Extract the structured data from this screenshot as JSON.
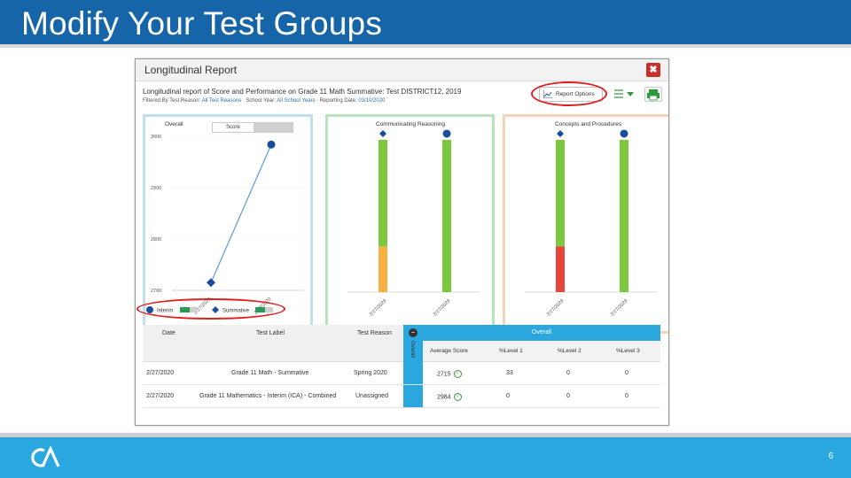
{
  "slide": {
    "title": "Modify Your Test Groups",
    "page_number": "6",
    "colors": {
      "header": "#1565a8",
      "footer": "#2aa7df",
      "highlight": "#e01e1e"
    }
  },
  "report": {
    "window_title": "Longitudinal Report",
    "description": "Longitudinal report of Score and Performance on Grade 11 Math   Summative: Test DISTRICT12, 2019",
    "filter_prefix": "Filtered By Test Reason:",
    "filter_test_reason": "All Test Reasons",
    "filter_school_year_label": "School Year:",
    "filter_school_year": "All School Years",
    "reporting_date_label": "Reporting Date:",
    "reporting_date": "03/10/2020",
    "report_options_label": "Report Options"
  },
  "panels": {
    "overall_label": "Overall",
    "score_toggle": "Score",
    "communicating_label": "Communicating Reasoning",
    "concepts_label": "Concepts and Procedures",
    "y_ticks": [
      "3000",
      "2900",
      "2800",
      "2700"
    ],
    "x_ticks": [
      "2/27/2020",
      "2/27/2020"
    ]
  },
  "chart_data": [
    {
      "type": "line",
      "title": "Overall",
      "x": [
        "2/27/2020",
        "2/27/2020"
      ],
      "series": [
        {
          "name": "Interim",
          "values": [
            null,
            2984
          ]
        },
        {
          "name": "Summative",
          "values": [
            2715,
            null
          ]
        }
      ],
      "ylim": [
        2700,
        3000
      ]
    },
    {
      "type": "bar",
      "title": "Communicating Reasoning",
      "categories": [
        "2/27/2020",
        "2/27/2020"
      ],
      "segments": [
        [
          "orange",
          "green"
        ],
        [
          "green"
        ]
      ]
    },
    {
      "type": "bar",
      "title": "Concepts and Procedures",
      "categories": [
        "2/27/2020",
        "2/27/2020"
      ],
      "segments": [
        [
          "red",
          "green"
        ],
        [
          "green"
        ]
      ]
    }
  ],
  "legend": {
    "interim": "Interim",
    "summative": "Summative"
  },
  "table": {
    "headers": [
      "Date",
      "Test Label",
      "Test Reason"
    ],
    "collapse_label": "Overall",
    "overall_group": "Overall",
    "sub_headers": [
      "Average Score",
      "%Level 1",
      "%Level 2",
      "%Level 3"
    ],
    "rows": [
      {
        "date": "2/27/2020",
        "label": "Grade 11 Math - Summative",
        "reason": "Spring 2020",
        "score": "2715",
        "l1": "33",
        "l2": "0",
        "l3": "0"
      },
      {
        "date": "2/27/2020",
        "label": "Grade 11 Mathematics - Interim (ICA) - Combined",
        "reason": "Unassigned",
        "score": "2984",
        "l1": "0",
        "l2": "0",
        "l3": "0"
      }
    ]
  }
}
